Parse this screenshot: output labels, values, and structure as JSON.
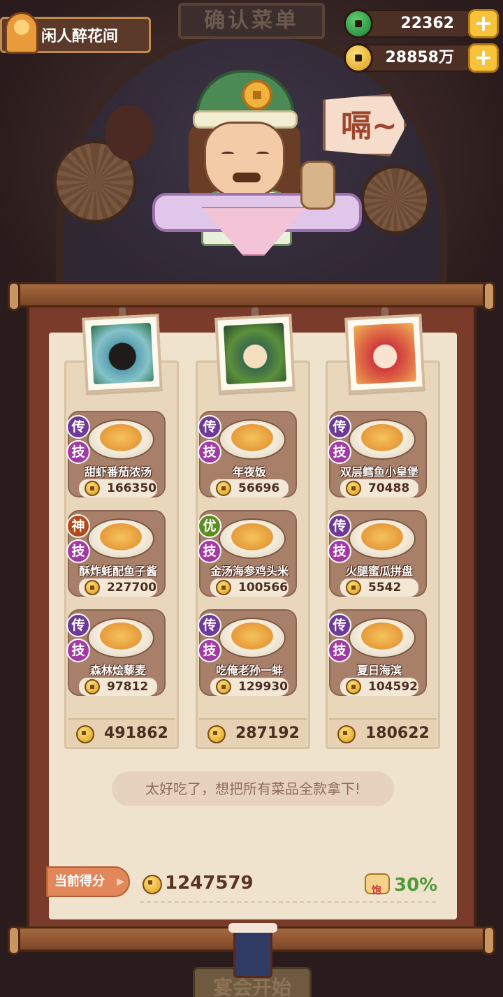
{
  "header": {
    "sign_text": "确认菜单",
    "player_name": "闲人醉花间",
    "jade_amount": "22362",
    "gold_amount": "28858万",
    "plus_label": "+"
  },
  "character": {
    "speech_text": "嗝~"
  },
  "columns": [
    {
      "dishes": [
        {
          "rank": "传",
          "skill": "技",
          "name": "甜虾番茄浓汤",
          "price": "166350"
        },
        {
          "rank": "神",
          "skill": "技",
          "name": "酥炸蚝配鱼子酱",
          "price": "227700"
        },
        {
          "rank": "传",
          "skill": "技",
          "name": "森林烩藜麦",
          "price": "97812"
        }
      ],
      "subtotal": "491862"
    },
    {
      "dishes": [
        {
          "rank": "传",
          "skill": "技",
          "name": "年夜饭",
          "price": "56696"
        },
        {
          "rank": "优",
          "skill": "技",
          "name": "金汤海参鸡头米",
          "price": "100566"
        },
        {
          "rank": "传",
          "skill": "技",
          "name": "吃俺老孙一蚌",
          "price": "129930"
        }
      ],
      "subtotal": "287192"
    },
    {
      "dishes": [
        {
          "rank": "传",
          "skill": "技",
          "name": "双层鳕鱼小皇堡",
          "price": "70488"
        },
        {
          "rank": "传",
          "skill": "技",
          "name": "火腿蜜瓜拼盘",
          "price": "5542"
        },
        {
          "rank": "传",
          "skill": "技",
          "name": "夏日海滨",
          "price": "104592"
        }
      ],
      "subtotal": "180622"
    }
  ],
  "comment": "太好吃了，想把所有菜品全款拿下!",
  "score": {
    "label": "当前得分",
    "total": "1247579",
    "bonus_percent": "30%"
  },
  "footer": {
    "start_button": "宴会开始"
  },
  "colors": {
    "panel_bg": "#f0e3cd",
    "rank_legend": "#6e3a97",
    "rank_god": "#b34a1a",
    "rank_excellent": "#5f8d22",
    "skill": "#a23aa3",
    "bonus_green": "#4f9a3a"
  }
}
